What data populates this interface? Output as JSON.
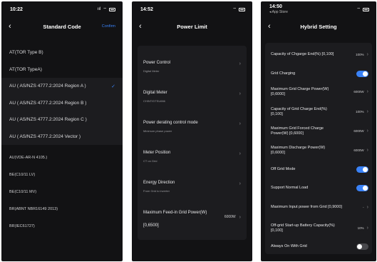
{
  "colors": {
    "accent": "#3a82f7",
    "background": "#121214",
    "card": "#1c1c1f"
  },
  "panel1": {
    "status": {
      "time": "10:22",
      "signal": "ııl",
      "wifi": "⌔"
    },
    "nav": {
      "back": "‹",
      "title": "Standard Code",
      "confirm": "Confirm"
    },
    "items": [
      {
        "label": "AT(TOR Type B)",
        "selected": false
      },
      {
        "label": "AT(TOR TypeA)",
        "selected": false
      },
      {
        "label": "AU ( AS/NZS 4777.2:2024 Region A )",
        "selected": true,
        "check": "✓"
      },
      {
        "label": "AU ( AS/NZS 4777.2:2024 Region B )",
        "selected": false
      },
      {
        "label": "AU ( AS/NZS 4777.2:2024 Region C )",
        "selected": false
      },
      {
        "label": "AU ( AS/NZS 4777.2:2024 Vector )",
        "selected": false
      },
      {
        "label": "AU(VDE-AR-N 4105.)",
        "selected": false
      },
      {
        "label": "BE(C10/11 LV)",
        "selected": false
      },
      {
        "label": "BE(C10/11 MV)",
        "selected": false
      },
      {
        "label": "BR(ABNT NBR16149 2013)",
        "selected": false
      },
      {
        "label": "BR(IEC61727)",
        "selected": false
      }
    ]
  },
  "panel2": {
    "status": {
      "time": "14:52",
      "wifi": "⌔"
    },
    "nav": {
      "back": "‹",
      "title": "Power Limit"
    },
    "rows": [
      {
        "label": "Power Control",
        "sub": "Digital Meter",
        "value": ""
      },
      {
        "label": "Digital Meter",
        "sub": "CHINT/DTSU666",
        "value": ""
      },
      {
        "label": "Power derating control mode",
        "sub": "Minimum phase power",
        "value": ""
      },
      {
        "label": "Meter Position",
        "sub": "CT on Grid",
        "value": ""
      },
      {
        "label": "Energy Direction",
        "sub": "From Grid to inverter",
        "value": ""
      },
      {
        "label": "Maximum Feed-in Grid Power(W) [0,6500]",
        "sub": "",
        "value": "6000W"
      }
    ]
  },
  "panel3": {
    "status": {
      "time": "14:50",
      "sub": "◂ App Store",
      "wifi": "⌔"
    },
    "nav": {
      "back": "‹",
      "title": "Hybrid Setting"
    },
    "rows": [
      {
        "label": "Capacity of Chgarge End(%) [0,100]",
        "value": "100%",
        "control": "chevron"
      },
      {
        "label": "Grid Charging",
        "value": "",
        "control": "toggle-on"
      },
      {
        "label": "Maximum Grid Charge Power(W) [0,6000]",
        "value": "6000W",
        "control": "chevron"
      },
      {
        "label": "Capacity of Grid Charge End(%) [0,100]",
        "value": "100%",
        "control": "chevron"
      },
      {
        "label": "Maximum Grid Forced Charge Power(W) [0,6000]",
        "value": "6000W",
        "control": "chevron"
      },
      {
        "label": "Maximum Discharge Power(W) [0,6000]",
        "value": "6000W",
        "control": "chevron"
      },
      {
        "label": "Off Grid Mode",
        "value": "",
        "control": "toggle-on"
      },
      {
        "label": "Support Normal Load",
        "value": "",
        "control": "toggle-on"
      },
      {
        "label": "Maximum Input power from Grid [0,9000]",
        "value": "-",
        "control": "chevron"
      },
      {
        "label": "Off-grid Start-up Battery Capacity(%) [0,100]",
        "value": "10%",
        "control": "chevron"
      },
      {
        "label": "Always On With Grid",
        "value": "",
        "control": "toggle-off"
      }
    ]
  },
  "icons": {
    "chevron": "›"
  }
}
